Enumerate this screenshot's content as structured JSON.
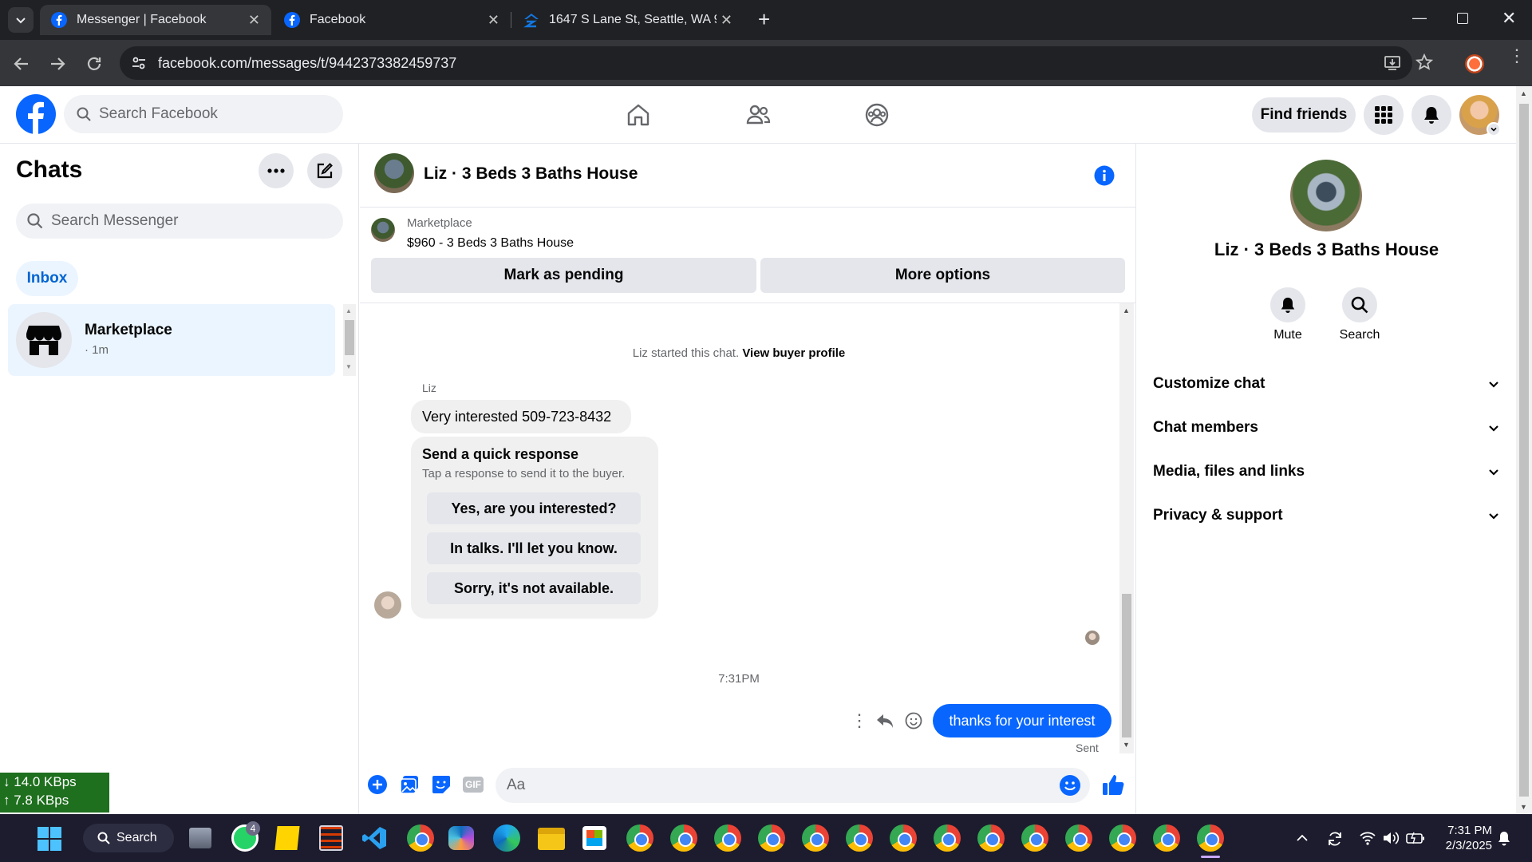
{
  "browser": {
    "tabs": [
      {
        "title": "Messenger | Facebook",
        "active": true
      },
      {
        "title": "Facebook",
        "active": false
      },
      {
        "title": "1647 S Lane St, Seattle, WA 981",
        "active": false
      }
    ],
    "url": "facebook.com/messages/t/9442373382459737"
  },
  "header": {
    "search_placeholder": "Search Facebook",
    "find_friends": "Find friends"
  },
  "chats": {
    "title": "Chats",
    "search_placeholder": "Search Messenger",
    "filter_inbox": "Inbox",
    "items": [
      {
        "name": "Marketplace",
        "meta": "· 1m"
      }
    ]
  },
  "conversation": {
    "title": "Liz · 3 Beds 3 Baths House",
    "listing_source": "Marketplace",
    "listing_title": "$960 - 3 Beds 3 Baths House",
    "mark_pending": "Mark as pending",
    "more_options": "More options",
    "system_text": "Liz started this chat.",
    "system_link": "View buyer profile",
    "sender_name": "Liz",
    "incoming_message": "Very interested 509-723-8432",
    "quick_title": "Send a quick response",
    "quick_subtitle": "Tap a response to send it to the buyer.",
    "quick_responses": [
      "Yes, are you interested?",
      "In talks. I'll let you know.",
      "Sorry, it's not available."
    ],
    "timestamp": "7:31PM",
    "outgoing_message": "thanks for your interest",
    "status": "Sent",
    "composer_placeholder": "Aa"
  },
  "profile": {
    "name": "Liz · 3 Beds 3 Baths House",
    "mute": "Mute",
    "search": "Search",
    "sections": [
      "Customize chat",
      "Chat members",
      "Media, files and links",
      "Privacy & support"
    ]
  },
  "netspeed": {
    "down": "14.0 KBps",
    "up": "7.8 KBps"
  },
  "taskbar": {
    "search_label": "Search",
    "whatsapp_badge": "4",
    "time": "7:31 PM",
    "date": "2/3/2025"
  },
  "colors": {
    "fb_blue": "#0866ff",
    "bubble_gray": "#f0f0f0",
    "selected_chat": "#ebf5ff"
  }
}
